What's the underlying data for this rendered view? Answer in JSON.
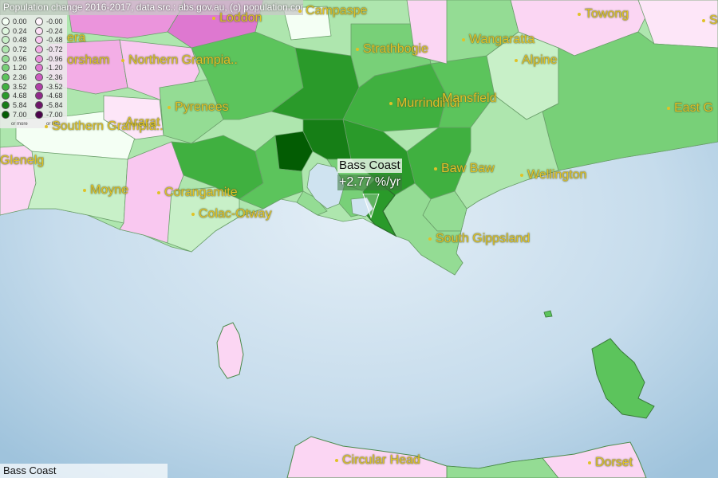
{
  "header": {
    "title": "Population change 2016-2017, data src.: abs.gov.au, (c) population.com.au"
  },
  "legend": {
    "positive": [
      {
        "label": "0.00",
        "color": "#f4fff4"
      },
      {
        "label": "0.24",
        "color": "#dff7df"
      },
      {
        "label": "0.48",
        "color": "#c8f0c8"
      },
      {
        "label": "0.72",
        "color": "#aee6ae"
      },
      {
        "label": "0.96",
        "color": "#94dc94"
      },
      {
        "label": "1.20",
        "color": "#78d078"
      },
      {
        "label": "2.36",
        "color": "#5cc45c"
      },
      {
        "label": "3.52",
        "color": "#40b040"
      },
      {
        "label": "4.68",
        "color": "#2a9a2a"
      },
      {
        "label": "5.84",
        "color": "#167e16"
      },
      {
        "label": "7.00",
        "color": "#035c03"
      }
    ],
    "negative": [
      {
        "label": "-0.00",
        "color": "#fff4fc"
      },
      {
        "label": "-0.24",
        "color": "#fddff6"
      },
      {
        "label": "-0.48",
        "color": "#f9c8f0"
      },
      {
        "label": "-0.72",
        "color": "#f3aee6"
      },
      {
        "label": "-0.96",
        "color": "#eb94dc"
      },
      {
        "label": "-1.20",
        "color": "#de78d0"
      },
      {
        "label": "-2.36",
        "color": "#cc5cc0"
      },
      {
        "label": "-3.52",
        "color": "#b040a8"
      },
      {
        "label": "-4.68",
        "color": "#902a8a"
      },
      {
        "label": "-5.84",
        "color": "#6e166a"
      },
      {
        "label": "-7.00",
        "color": "#4c034c"
      }
    ],
    "footer_positive": "or more",
    "footer_negative": "or less"
  },
  "places": [
    {
      "name": "Campaspe"
    },
    {
      "name": "Towong"
    },
    {
      "name": "Loddon"
    },
    {
      "name": "Strathbogie"
    },
    {
      "name": "Wangaratta"
    },
    {
      "name": "Alpine"
    },
    {
      "name": "Northern Grampia.."
    },
    {
      "name": "Murrindindi"
    },
    {
      "name": "Mansfield"
    },
    {
      "name": "Pyrenees"
    },
    {
      "name": "East G"
    },
    {
      "name": "Southern Grampia.."
    },
    {
      "name": "Glenelg"
    },
    {
      "name": "Baw Baw"
    },
    {
      "name": "Wellington"
    },
    {
      "name": "Moyne"
    },
    {
      "name": "Corangamite"
    },
    {
      "name": "Colac-Otway"
    },
    {
      "name": "South Gippsland"
    },
    {
      "name": "Circular Head"
    },
    {
      "name": "Dorset"
    }
  ],
  "partial_labels": {
    "horsham": "orsham",
    "ararat": "Ararat",
    "era": "era",
    "su": "Su"
  },
  "tooltip": {
    "name": "Bass Coast",
    "value": "+2.77 %/yr"
  },
  "status": {
    "selected": "Bass Coast"
  },
  "colors": {
    "sea": "#c9dfee",
    "border": "#6a9e6a"
  }
}
